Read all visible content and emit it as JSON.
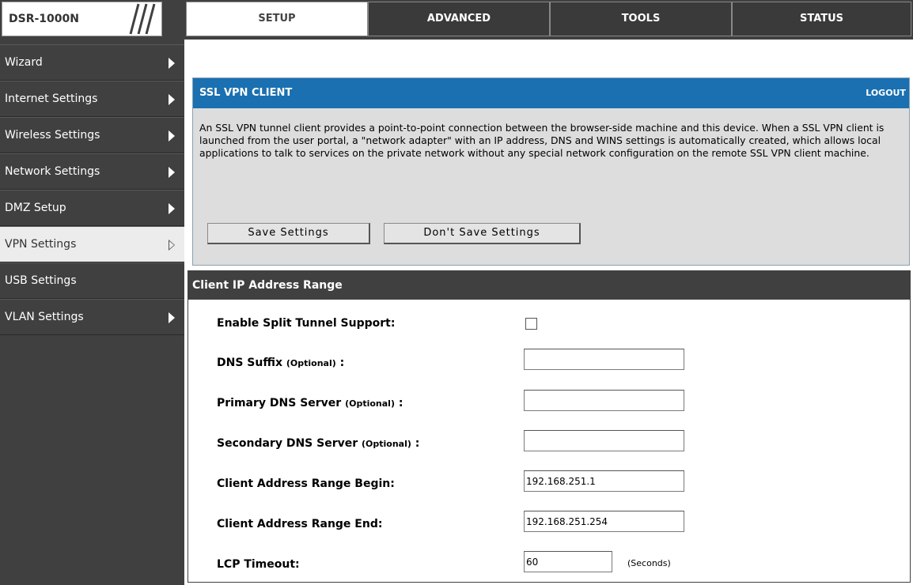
{
  "device": {
    "model": "DSR-1000N"
  },
  "tabs": [
    {
      "label": "SETUP",
      "active": true
    },
    {
      "label": "ADVANCED",
      "active": false
    },
    {
      "label": "TOOLS",
      "active": false
    },
    {
      "label": "STATUS",
      "active": false
    }
  ],
  "sidebar": {
    "items": [
      {
        "label": "Wizard",
        "arrow": "solid"
      },
      {
        "label": "Internet Settings",
        "arrow": "solid"
      },
      {
        "label": "Wireless Settings",
        "arrow": "solid"
      },
      {
        "label": "Network Settings",
        "arrow": "solid"
      },
      {
        "label": "DMZ Setup",
        "arrow": "solid"
      },
      {
        "label": "VPN Settings",
        "arrow": "hollow",
        "active": true
      },
      {
        "label": "USB Settings",
        "arrow": "none"
      },
      {
        "label": "VLAN Settings",
        "arrow": "solid"
      }
    ]
  },
  "ssl_panel": {
    "title": "SSL VPN CLIENT",
    "logout": "LOGOUT",
    "description": "An SSL VPN tunnel client provides a point-to-point connection between the browser-side machine and this device. When a SSL VPN client is launched from the user portal, a \"network adapter\" with an IP address, DNS and WINS settings is automatically created, which allows local applications to talk to services on the private network without any special network configuration on the remote SSL VPN client machine.",
    "save_button": "Save Settings",
    "dont_save_button": "Don't Save Settings"
  },
  "range_panel": {
    "title": "Client IP Address Range",
    "rows": {
      "split_tunnel": {
        "label": "Enable Split Tunnel Support:",
        "checked": false
      },
      "dns_suffix": {
        "label": "DNS Suffix ",
        "optional": "(Optional)",
        "suffix": " :",
        "value": ""
      },
      "primary_dns": {
        "label": "Primary DNS Server ",
        "optional": "(Optional)",
        "suffix": " :",
        "value": ""
      },
      "secondary_dns": {
        "label": "Secondary DNS Server ",
        "optional": "(Optional)",
        "suffix": " :",
        "value": ""
      },
      "range_begin": {
        "label": "Client Address Range Begin:",
        "value": "192.168.251.1"
      },
      "range_end": {
        "label": "Client Address Range End:",
        "value": "192.168.251.254"
      },
      "lcp_timeout": {
        "label": "LCP Timeout:",
        "value": "60",
        "unit": "(Seconds)"
      }
    }
  },
  "colors": {
    "bar": "#404040",
    "ssl_header": "#1a70b0",
    "panel_bg": "#dddddd"
  }
}
